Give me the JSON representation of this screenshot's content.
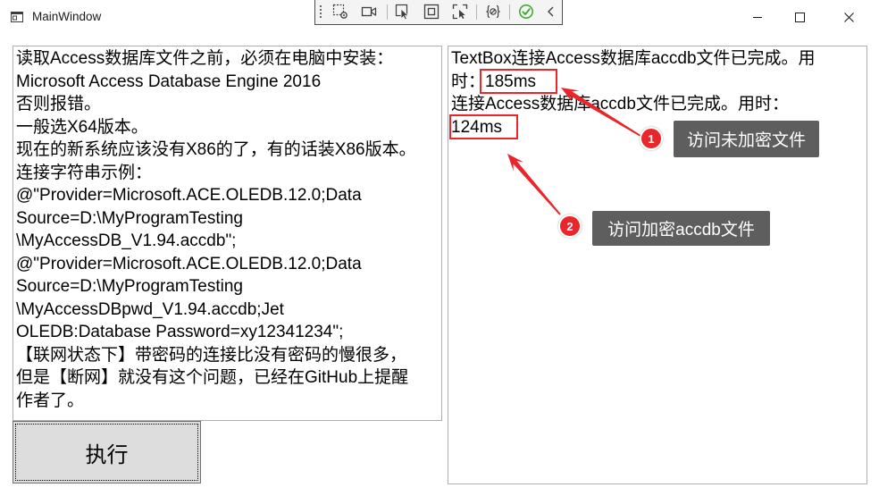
{
  "window": {
    "title": "MainWindow",
    "icon": "app-window-icon",
    "controls": [
      "minimize-icon",
      "maximize-icon",
      "close-icon"
    ]
  },
  "debug_toolbar": {
    "icons": [
      "grip-icon",
      "select-element-icon",
      "video-camera-icon",
      "pointer-select-icon",
      "layout-adorners-icon",
      "track-focus-icon",
      "hot-reload-icon",
      "check-circle-icon",
      "chevron-left-icon"
    ]
  },
  "left_textbox": {
    "lines": [
      "读取Access数据库文件之前，必须在电脑中安装：",
      "Microsoft Access Database Engine 2016",
      "否则报错。",
      "一般选X64版本。",
      "现在的新系统应该没有X86的了，有的话装X86版本。",
      "连接字符串示例：",
      "@\"Provider=Microsoft.ACE.OLEDB.12.0;Data",
      "Source=D:\\MyProgramTesting",
      "\\MyAccessDB_V1.94.accdb\";",
      "@\"Provider=Microsoft.ACE.OLEDB.12.0;Data",
      "Source=D:\\MyProgramTesting",
      "\\MyAccessDBpwd_V1.94.accdb;Jet",
      "OLEDB:Database Password=xy12341234\";",
      "【联网状态下】带密码的连接比没有密码的慢很多，",
      "但是【断网】就没有这个问题，已经在GitHub上提醒",
      "作者了。"
    ]
  },
  "execute_button": {
    "label": "执行"
  },
  "right_textbox": {
    "lines": [
      "TextBox连接Access数据库accdb文件已完成。用",
      "时：185ms",
      "连接Access数据库accdb文件已完成。用时：",
      "124ms"
    ]
  },
  "annotations": [
    {
      "number": "1",
      "label": "访问未加密文件"
    },
    {
      "number": "2",
      "label": "访问加密accdb文件"
    }
  ],
  "colors": {
    "annotation_red": "#e8262b",
    "callout_background": "#5e5e5e",
    "button_background": "#dddddd",
    "status_green": "#3aa629",
    "textbox_border": "#abadb3"
  }
}
